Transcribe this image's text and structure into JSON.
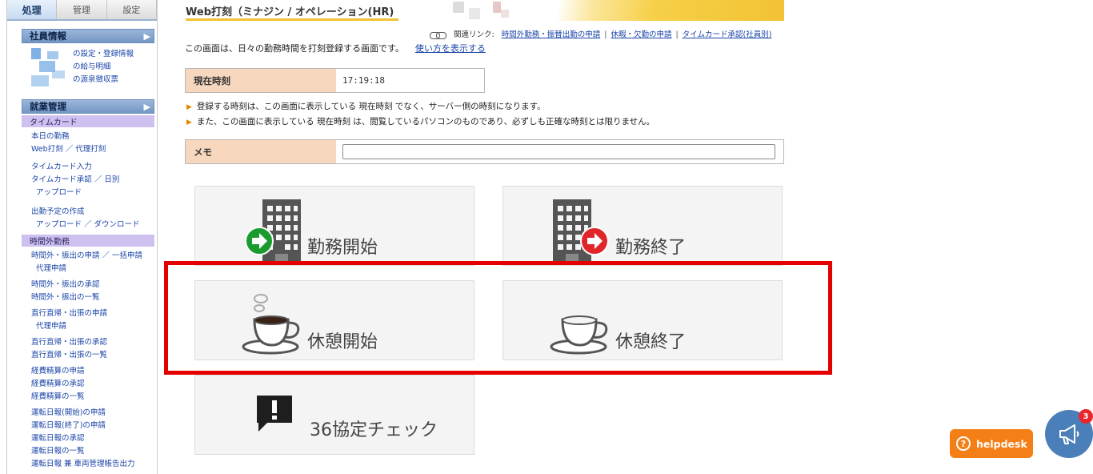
{
  "sidebar": {
    "tabs": [
      "処理",
      "管理",
      "設定"
    ],
    "employee_section": "社員情報",
    "employee_links": [
      "の設定・登録情報",
      "の給与明細",
      "の源泉徴収票"
    ],
    "work_section": "就業管理",
    "timecard_header": "タイムカード",
    "timecard_links": {
      "today": "本日の勤務",
      "web_punch": "Web打刻 ／ 代理打刻",
      "input": "タイムカード入力",
      "approval": "タイムカード承認 ／ 日別",
      "upload": "アップロード",
      "schedule": "出勤予定の作成",
      "up_down": "アップロード ／ ダウンロード"
    },
    "overtime_header": "時間外勤務",
    "overtime_links": {
      "apply": "時間外・振出の申請 ／ 一括申請",
      "proxy1": "代理申請",
      "approve": "時間外・振出の承認",
      "list": "時間外・振出の一覧",
      "direct_apply": "直行直帰・出張の申請",
      "proxy2": "代理申請",
      "direct_approve": "直行直帰・出張の承認",
      "direct_list": "直行直帰・出張の一覧",
      "expense_apply": "経費精算の申請",
      "expense_approve": "経費精算の承認",
      "expense_list": "経費精算の一覧",
      "drive_start": "運転日報(開始)の申請",
      "drive_end": "運転日報(終了)の申請",
      "drive_approve": "運転日報の承認",
      "drive_list": "運転日報の一覧",
      "drive_vehicle": "運転日報 兼 車両管理帳告出力"
    }
  },
  "page": {
    "title": "Web打刻（ミナジン / オペレーション(HR)",
    "related_label": "関連リンク:",
    "related_links": [
      "時間外勤務・振替出勤の申請",
      "休暇・欠勤の申請",
      "タイムカード承認(社員別)"
    ],
    "intro": "この画面は、日々の勤務時間を打刻登録する画面です。",
    "howto_link": "使い方を表示する",
    "current_time_label": "現在時刻",
    "current_time_value": "17:19:18",
    "note1": "登録する時刻は、この画面に表示している 現在時刻 でなく、サーバー側の時刻になります。",
    "note2": "また、この画面に表示している 現在時刻 は、閲覧しているパソコンのものであり、必ずしも正確な時刻とは限りません。",
    "memo_label": "メモ",
    "memo_value": ""
  },
  "buttons": {
    "work_start": "勤務開始",
    "work_end": "勤務終了",
    "break_start": "休憩開始",
    "break_end": "休憩終了",
    "agreement_check": "36協定チェック"
  },
  "floating": {
    "helpdesk": "helpdesk",
    "badge_count": "3"
  },
  "colors": {
    "highlight": "#e50000",
    "helpdesk": "#f57f17",
    "announce": "#4a7fb9",
    "label_bg": "#f7d7bd",
    "start_arrow": "#1a9b2d",
    "end_arrow": "#e0262b"
  },
  "icons": [
    "building-icon",
    "arrow-right-green-icon",
    "arrow-right-red-icon",
    "coffee-cup-steam-icon",
    "coffee-cup-icon",
    "exclamation-bubble-icon",
    "chain-link-icon",
    "question-circle-icon",
    "megaphone-icon"
  ]
}
